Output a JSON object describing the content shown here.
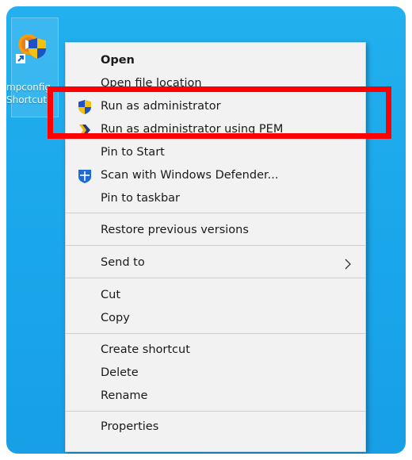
{
  "shortcut": {
    "label_line1": "mpconfig",
    "label_line2": "Shortcut",
    "icon": "app-shortcut-icon"
  },
  "menu": {
    "items": [
      {
        "label": "Open",
        "bold": true
      },
      {
        "label": "Open file location"
      },
      {
        "label": "Run as administrator",
        "icon": "uac-shield-icon"
      },
      {
        "label": "Run as administrator using PEM",
        "icon": "pem-icon"
      },
      {
        "label": "Pin to Start"
      },
      {
        "label": "Scan with Windows Defender...",
        "icon": "windows-defender-icon"
      },
      {
        "label": "Pin to taskbar"
      },
      {
        "label": "Restore previous versions"
      },
      {
        "label": "Send to",
        "submenu": true
      },
      {
        "label": "Cut"
      },
      {
        "label": "Copy"
      },
      {
        "label": "Create shortcut"
      },
      {
        "label": "Delete"
      },
      {
        "label": "Rename"
      },
      {
        "label": "Properties"
      }
    ]
  },
  "colors": {
    "desktop": "#1aa6ea",
    "menu_bg": "#f2f2f2",
    "highlight": "#ff0000",
    "pem_icon": "#1f3a8a",
    "defender_icon": "#1e6ad9"
  }
}
